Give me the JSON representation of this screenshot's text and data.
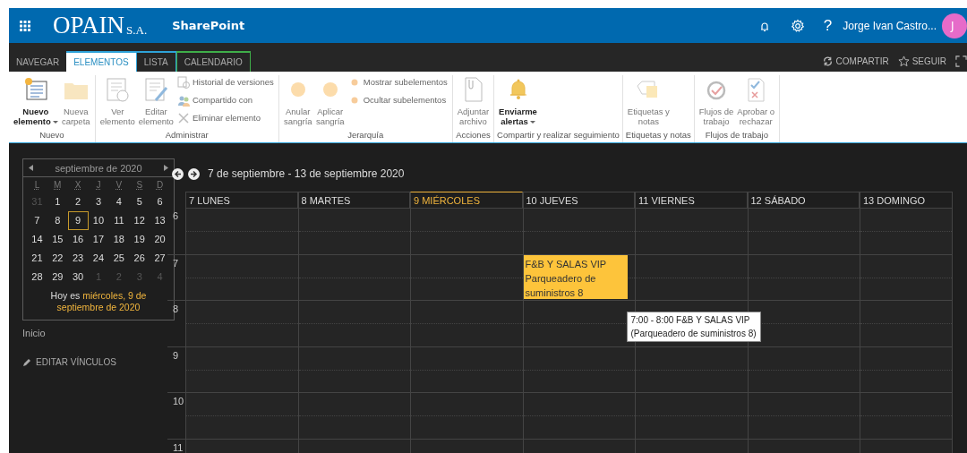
{
  "header": {
    "logo": "OPAIN",
    "logo_suffix": "S.A.",
    "site": "SharePoint",
    "help": "?",
    "user": "Jorge Ivan Castro...",
    "avatar": "J"
  },
  "ribbon_tabs": [
    {
      "label": "NAVEGAR",
      "selected": false
    },
    {
      "label": "ELEMENTOS",
      "selected": true,
      "color": "#2ea2d8"
    },
    {
      "label": "LISTA",
      "selected": false,
      "color": "#2ea2d8"
    },
    {
      "label": "CALENDARIO",
      "selected": false,
      "color": "#3fae49"
    }
  ],
  "ribbon_actions": [
    {
      "label": "COMPARTIR",
      "kind": "share"
    },
    {
      "label": "SEGUIR",
      "kind": "follow"
    },
    {
      "kind": "focus"
    }
  ],
  "ribbon_groups": [
    {
      "label": "Nuevo",
      "buttons": [
        {
          "kind": "large",
          "lines": [
            "Nuevo",
            "elemento"
          ],
          "dropdown": true,
          "disabled": false
        },
        {
          "kind": "large",
          "lines": [
            "Nueva",
            "carpeta"
          ],
          "dropdown": false,
          "disabled": true
        }
      ]
    },
    {
      "label": "Administrar",
      "buttons": [
        {
          "kind": "large",
          "lines": [
            "Ver",
            "elemento"
          ],
          "dropdown": false,
          "disabled": true
        },
        {
          "kind": "large",
          "lines": [
            "Editar",
            "elemento"
          ],
          "dropdown": false,
          "disabled": true
        },
        {
          "kind": "small",
          "lines": [
            "Historial de versiones"
          ],
          "disabled": true
        },
        {
          "kind": "small",
          "lines": [
            "Compartido con"
          ],
          "disabled": true
        },
        {
          "kind": "small",
          "lines": [
            "Eliminar elemento"
          ],
          "disabled": true
        }
      ]
    },
    {
      "label": "Jerarquía",
      "buttons": [
        {
          "kind": "large",
          "lines": [
            "Anular",
            "sangría"
          ],
          "dropdown": false,
          "disabled": true
        },
        {
          "kind": "large",
          "lines": [
            "Aplicar",
            "sangría"
          ],
          "dropdown": false,
          "disabled": true
        },
        {
          "kind": "small",
          "lines": [
            "Mostrar subelementos"
          ],
          "disabled": true
        },
        {
          "kind": "small",
          "lines": [
            "Ocultar subelementos"
          ],
          "disabled": true
        }
      ]
    },
    {
      "label": "Acciones",
      "buttons": [
        {
          "kind": "large",
          "lines": [
            "Adjuntar",
            "archivo"
          ],
          "dropdown": false,
          "disabled": true
        }
      ]
    },
    {
      "label": "Compartir y realizar seguimiento",
      "buttons": [
        {
          "kind": "large",
          "lines": [
            "Enviarme",
            "alertas"
          ],
          "dropdown": true,
          "disabled": false
        }
      ]
    },
    {
      "label": "Etiquetas y notas",
      "buttons": [
        {
          "kind": "large",
          "lines": [
            "Etiquetas y",
            "notas"
          ],
          "dropdown": false,
          "disabled": true
        }
      ]
    },
    {
      "label": "Flujos de trabajo",
      "buttons": [
        {
          "kind": "large",
          "lines": [
            "Flujos de",
            "trabajo"
          ],
          "dropdown": false,
          "disabled": true
        },
        {
          "kind": "large",
          "lines": [
            "Aprobar o",
            "rechazar"
          ],
          "dropdown": false,
          "disabled": true
        }
      ]
    }
  ],
  "mini_calendar": {
    "month": "septiembre de 2020",
    "weekdays": [
      "L",
      "M",
      "X",
      "J",
      "V",
      "S",
      "D"
    ],
    "weeks": [
      [
        {
          "label": "31",
          "other_month": true,
          "today": false
        },
        {
          "label": "1",
          "other_month": false,
          "today": false
        },
        {
          "label": "2",
          "other_month": false,
          "today": false
        },
        {
          "label": "3",
          "other_month": false,
          "today": false
        },
        {
          "label": "4",
          "other_month": false,
          "today": false
        },
        {
          "label": "5",
          "other_month": false,
          "today": false
        },
        {
          "label": "6",
          "other_month": false,
          "today": false
        }
      ],
      [
        {
          "label": "7",
          "other_month": false,
          "today": false
        },
        {
          "label": "8",
          "other_month": false,
          "today": false
        },
        {
          "label": "9",
          "other_month": false,
          "today": true
        },
        {
          "label": "10",
          "other_month": false,
          "today": false
        },
        {
          "label": "11",
          "other_month": false,
          "today": false
        },
        {
          "label": "12",
          "other_month": false,
          "today": false
        },
        {
          "label": "13",
          "other_month": false,
          "today": false
        }
      ],
      [
        {
          "label": "14",
          "other_month": false,
          "today": false
        },
        {
          "label": "15",
          "other_month": false,
          "today": false
        },
        {
          "label": "16",
          "other_month": false,
          "today": false
        },
        {
          "label": "17",
          "other_month": false,
          "today": false
        },
        {
          "label": "18",
          "other_month": false,
          "today": false
        },
        {
          "label": "19",
          "other_month": false,
          "today": false
        },
        {
          "label": "20",
          "other_month": false,
          "today": false
        }
      ],
      [
        {
          "label": "21",
          "other_month": false,
          "today": false
        },
        {
          "label": "22",
          "other_month": false,
          "today": false
        },
        {
          "label": "23",
          "other_month": false,
          "today": false
        },
        {
          "label": "24",
          "other_month": false,
          "today": false
        },
        {
          "label": "25",
          "other_month": false,
          "today": false
        },
        {
          "label": "26",
          "other_month": false,
          "today": false
        },
        {
          "label": "27",
          "other_month": false,
          "today": false
        }
      ],
      [
        {
          "label": "28",
          "other_month": false,
          "today": false
        },
        {
          "label": "29",
          "other_month": false,
          "today": false
        },
        {
          "label": "30",
          "other_month": false,
          "today": false
        },
        {
          "label": "1",
          "other_month": true,
          "today": false
        },
        {
          "label": "2",
          "other_month": true,
          "today": false
        },
        {
          "label": "3",
          "other_month": true,
          "today": false
        },
        {
          "label": "4",
          "other_month": true,
          "today": false
        }
      ]
    ],
    "today_prefix": "Hoy es",
    "today_date": "miércoles, 9 de septiembre de 2020"
  },
  "nav": {
    "items": [
      "Inicio"
    ],
    "edit_links": "EDITAR VÍNCULOS"
  },
  "week": {
    "range": "7 de septiembre - 13 de septiembre 2020",
    "days": [
      {
        "label": "7 LUNES",
        "selected": false
      },
      {
        "label": "8 MARTES",
        "selected": false
      },
      {
        "label": "9 MIÉRCOLES",
        "selected": true
      },
      {
        "label": "10 JUEVES",
        "selected": false,
        "events": [
          {
            "title": "F&B Y SALAS VIP",
            "location": "Parqueadero de suministros 8",
            "tooltip": {
              "time": "7:00 - 8:00",
              "title": "F&B Y SALAS VIP",
              "location": "(Parqueadero de suministros 8)"
            }
          }
        ]
      },
      {
        "label": "11 VIERNES",
        "selected": false
      },
      {
        "label": "12 SÁBADO",
        "selected": false
      },
      {
        "label": "13 DOMINGO",
        "selected": false
      }
    ],
    "hours": [
      "6",
      "7",
      "8",
      "9",
      "10",
      "11"
    ]
  }
}
